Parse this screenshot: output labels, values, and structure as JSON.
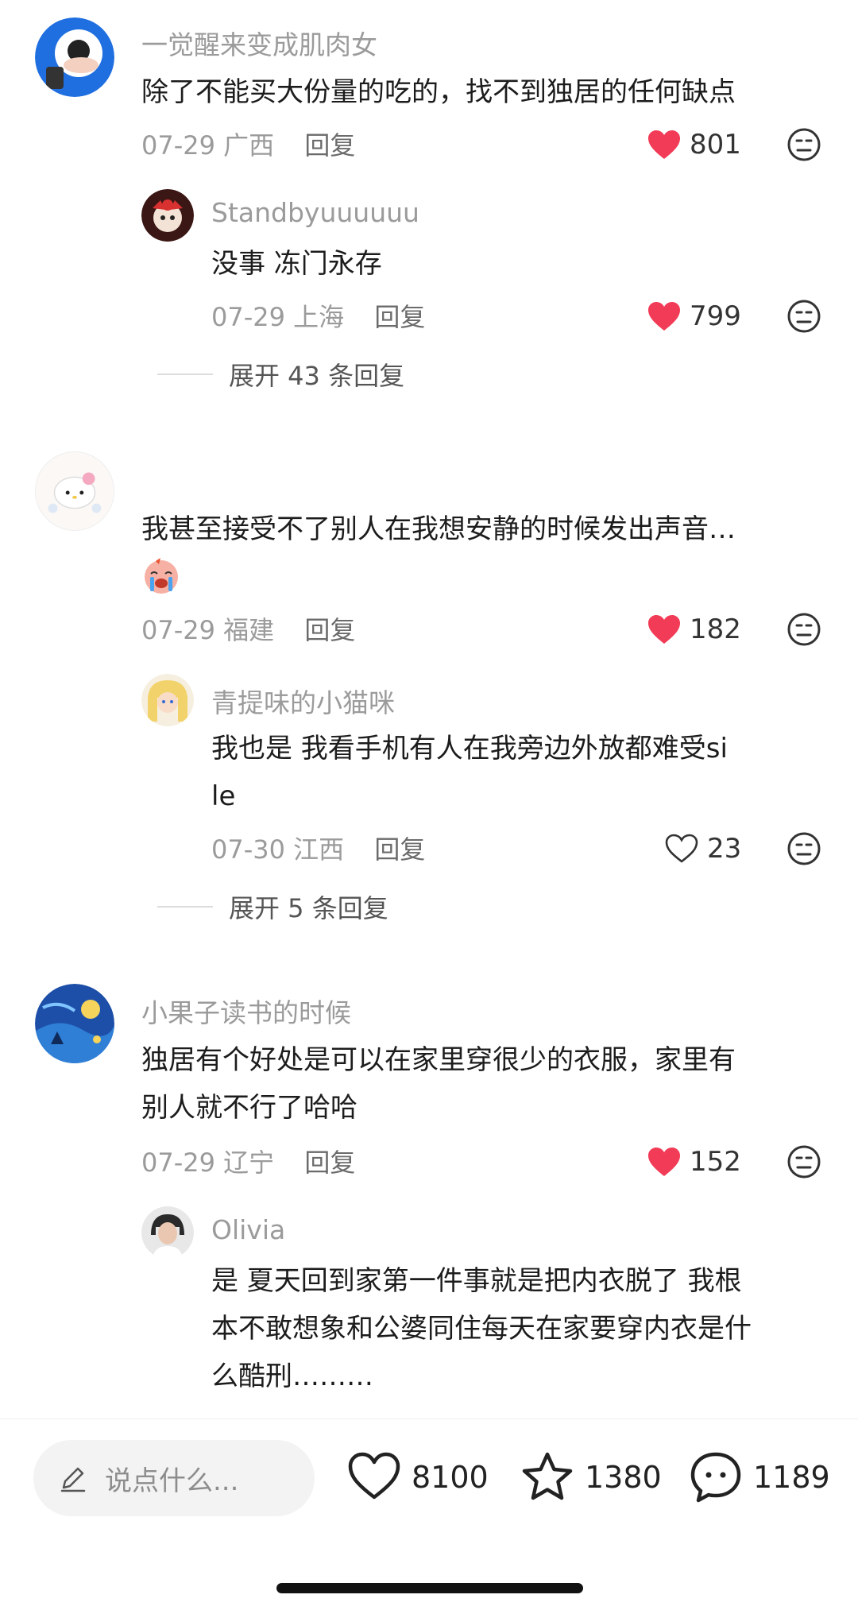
{
  "comments": [
    {
      "name": "一觉醒来变成肌肉女",
      "text": "除了不能买大份量的吃的，找不到独居的任何缺点",
      "date": "07-29",
      "location": "广西",
      "reply_label": "回复",
      "likes": "801",
      "liked": true,
      "reply": {
        "name": "Standbyuuuuuu",
        "text": "没事 冻门永存",
        "date": "07-29",
        "location": "上海",
        "reply_label": "回复",
        "likes": "799",
        "liked": true
      },
      "expand_label": "展开 43 条回复"
    },
    {
      "name": "",
      "text": "我甚至接受不了别人在我想安静的时候发出声音…",
      "emoji": "crying-face-emoji",
      "date": "07-29",
      "location": "福建",
      "reply_label": "回复",
      "likes": "182",
      "liked": true,
      "reply": {
        "name": "青提味的小猫咪",
        "text_line1": "我也是 我看手机有人在我旁边外放都难受si",
        "text_line2": "le",
        "date": "07-30",
        "location": "江西",
        "reply_label": "回复",
        "likes": "23",
        "liked": false
      },
      "expand_label": "展开 5 条回复"
    },
    {
      "name": "小果子读书的时候",
      "text_line1": "独居有个好处是可以在家里穿很少的衣服，家里有",
      "text_line2": "别人就不行了哈哈",
      "date": "07-29",
      "location": "辽宁",
      "reply_label": "回复",
      "likes": "152",
      "liked": true,
      "reply": {
        "name": "Olivia",
        "text_line1": "是 夏天回到家第一件事就是把内衣脱了 我根",
        "text_line2": "本不敢想象和公婆同住每天在家要穿内衣是什",
        "text_line3": "么酷刑………"
      }
    }
  ],
  "bottom_bar": {
    "input_placeholder": "说点什么...",
    "like_count": "8100",
    "favorite_count": "1380",
    "comment_count": "1189"
  },
  "colors": {
    "like_red": "#f23b56",
    "muted_text": "#9b9b9b",
    "body_text": "#1c1c1c"
  }
}
